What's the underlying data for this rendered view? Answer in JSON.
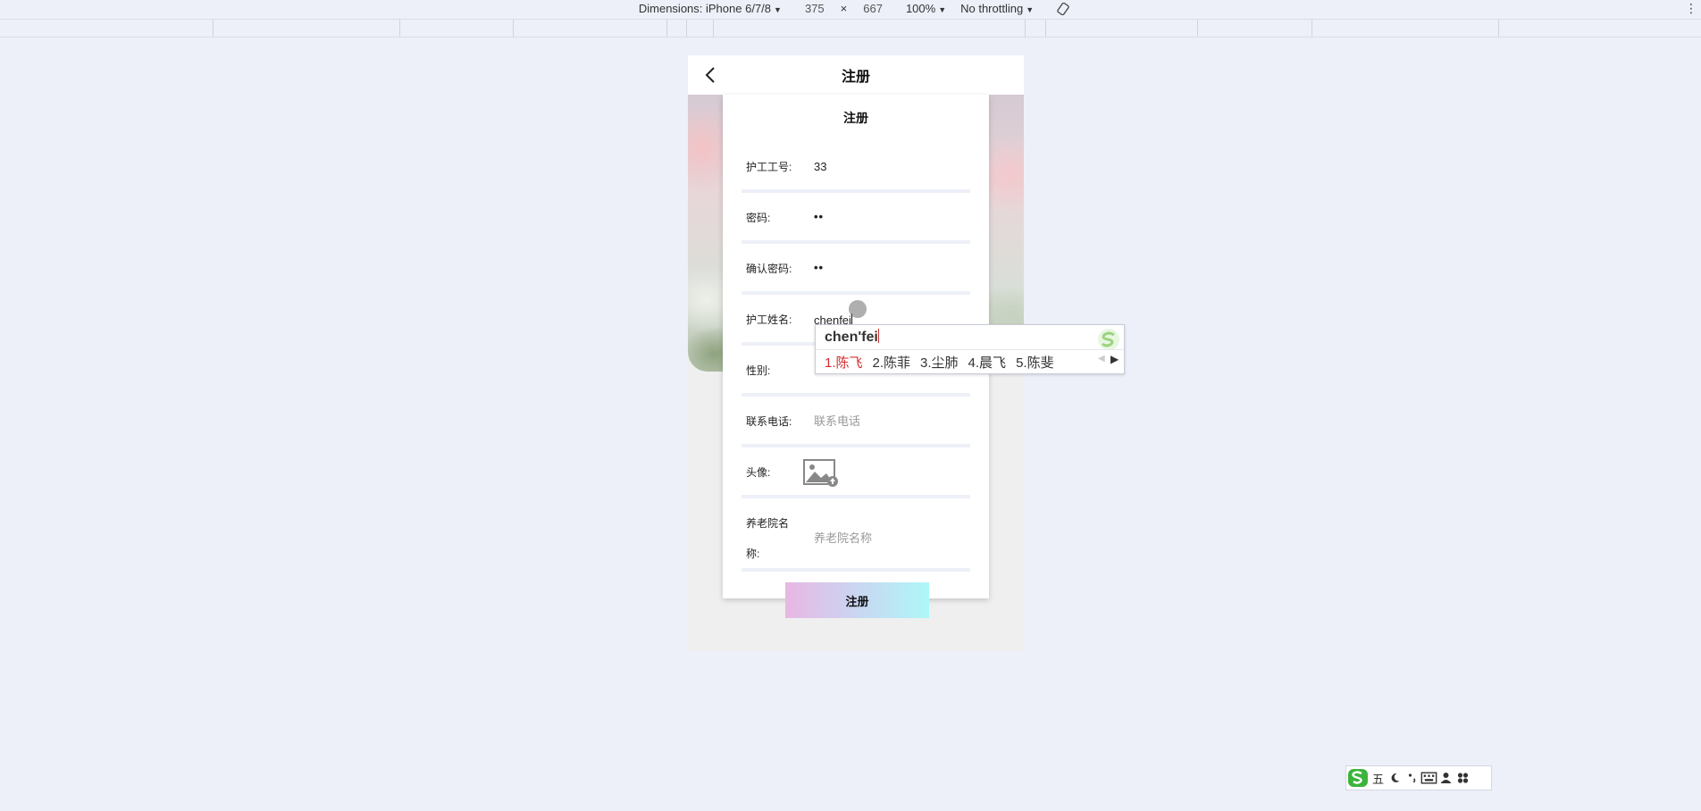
{
  "devtools": {
    "dimensions_label": "Dimensions: iPhone 6/7/8",
    "width": "375",
    "times": "×",
    "height": "667",
    "zoom": "100%",
    "throttling": "No throttling",
    "more": "⋮"
  },
  "nav": {
    "title": "注册"
  },
  "form": {
    "title": "注册",
    "fields": [
      {
        "label": "护工工号:",
        "value": "33"
      },
      {
        "label": "密码:",
        "value": "••"
      },
      {
        "label": "确认密码:",
        "value": "••"
      },
      {
        "label": "护工姓名:",
        "value": "chenfei"
      },
      {
        "label": "性别:",
        "value": ""
      },
      {
        "label": "联系电话:",
        "placeholder": "联系电话"
      },
      {
        "label": "头像:"
      },
      {
        "label_line1": "养老院名",
        "label_line2": "称:",
        "placeholder": "养老院名称"
      }
    ],
    "submit_label": "注册"
  },
  "ime": {
    "composition": "chen'fei",
    "candidates": [
      "1.陈飞",
      "2.陈菲",
      "3.尘肺",
      "4.晨飞",
      "5.陈斐"
    ],
    "selected_index": 0,
    "accent_color": "#d12b2b"
  },
  "ime_bar": {
    "mode": "五",
    "items": [
      "moon-icon",
      "punctuation-icon",
      "keyboard-icon",
      "user-icon",
      "apps-icon"
    ]
  }
}
